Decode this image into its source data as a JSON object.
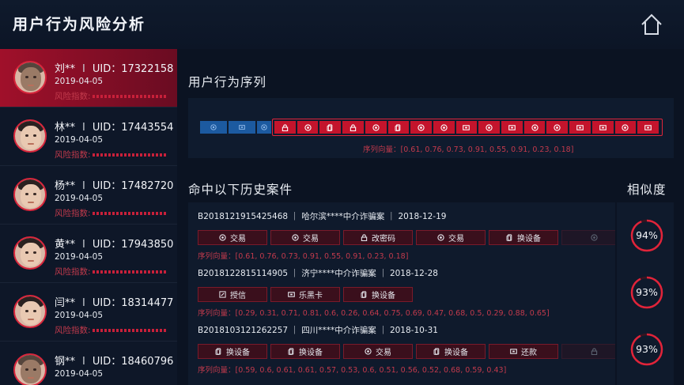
{
  "app": {
    "title": "用户行为风险分析"
  },
  "header": {
    "home_icon": "home-icon"
  },
  "users": [
    {
      "name": "刘**",
      "uid": "UID：17322158",
      "date": "2019-04-05",
      "risk_label": "风险指数:",
      "active": true
    },
    {
      "name": "林**",
      "uid": "UID：17443554",
      "date": "2019-04-05",
      "risk_label": "风险指数:",
      "active": false
    },
    {
      "name": "杨**",
      "uid": "UID：17482720",
      "date": "2019-04-05",
      "risk_label": "风险指数:",
      "active": false
    },
    {
      "name": "黄**",
      "uid": "UID：17943850",
      "date": "2019-04-05",
      "risk_label": "风险指数:",
      "active": false
    },
    {
      "name": "闫**",
      "uid": "UID：18314477",
      "date": "2019-04-05",
      "risk_label": "风险指数:",
      "active": false
    },
    {
      "name": "钢**",
      "uid": "UID：18460796",
      "date": "2019-04-05",
      "risk_label": "",
      "active": false
    }
  ],
  "sequence": {
    "title": "用户行为序列",
    "vector": "序列向量：[0.61, 0.76, 0.73, 0.91, 0.55, 0.91, 0.23, 0.18]",
    "blue_cells": [
      "coin-icon",
      "card-icon",
      "coin-icon"
    ],
    "red_cells": [
      "lock-icon",
      "coin-icon",
      "phone-icon",
      "lock-icon",
      "coin-icon",
      "phone-icon",
      "coin-icon",
      "coin-icon",
      "card-icon",
      "coin-icon",
      "card-icon",
      "coin-icon",
      "coin-icon",
      "card-icon",
      "card-icon",
      "coin-icon",
      "card-icon"
    ]
  },
  "cases": {
    "title": "命中以下历史案件",
    "similarity_title": "相似度",
    "items": [
      {
        "header": "B2018121915425468 ｜ 哈尔滨****中介诈骗案 ｜ 2018-12-19",
        "actions": [
          {
            "label": "交易",
            "icon": "coin-icon"
          },
          {
            "label": "交易",
            "icon": "coin-icon"
          },
          {
            "label": "改密码",
            "icon": "lock-icon"
          },
          {
            "label": "交易",
            "icon": "coin-icon"
          },
          {
            "label": "换设备",
            "icon": "phone-icon"
          },
          {
            "label": "",
            "icon": "coin-icon"
          }
        ],
        "vector": "序列向量：[0.61, 0.76, 0.73, 0.91, 0.55, 0.91, 0.23, 0.18]",
        "similarity": "94%",
        "similarity_value": 0.94
      },
      {
        "header": "B2018122815114905 ｜ 济宁****中介诈骗案 ｜ 2018-12-28",
        "actions": [
          {
            "label": "授信",
            "icon": "edit-icon"
          },
          {
            "label": "乐黑卡",
            "icon": "card-icon"
          },
          {
            "label": "换设备",
            "icon": "phone-icon"
          }
        ],
        "vector": "序列向量：[0.29, 0.31, 0.71, 0.81, 0.6, 0.26, 0.64, 0.75, 0.69, 0.47, 0.68, 0.5, 0.29, 0.88, 0.65]",
        "similarity": "93%",
        "similarity_value": 0.93
      },
      {
        "header": "B2018103121262257 ｜ 四川****中介诈骗案 ｜ 2018-10-31",
        "actions": [
          {
            "label": "换设备",
            "icon": "phone-icon"
          },
          {
            "label": "换设备",
            "icon": "phone-icon"
          },
          {
            "label": "交易",
            "icon": "coin-icon"
          },
          {
            "label": "换设备",
            "icon": "phone-icon"
          },
          {
            "label": "还款",
            "icon": "card-icon"
          },
          {
            "label": "",
            "icon": "lock-icon"
          }
        ],
        "vector": "序列向量：[0.59, 0.6, 0.61, 0.61, 0.57, 0.53, 0.6, 0.51, 0.56, 0.52, 0.68, 0.59, 0.43]",
        "similarity": "93%",
        "similarity_value": 0.93
      }
    ]
  }
}
